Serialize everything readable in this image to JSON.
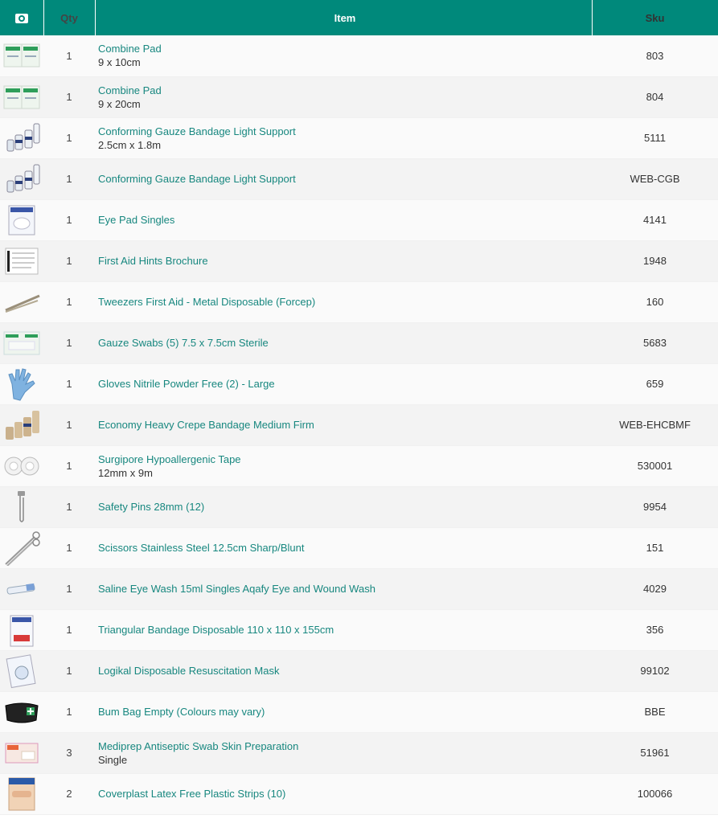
{
  "header": {
    "photo_icon": "camera-icon",
    "qty": "Qty",
    "item": "Item",
    "sku": "Sku"
  },
  "colors": {
    "header_bg": "#00897b",
    "link": "#17877f"
  },
  "rows": [
    {
      "icon": "combine-pad-thumbnail",
      "qty": "1",
      "name": "Combine Pad",
      "sub": "9 x 10cm",
      "sku": "803"
    },
    {
      "icon": "combine-pad-thumbnail",
      "qty": "1",
      "name": "Combine Pad",
      "sub": "9 x 20cm",
      "sku": "804"
    },
    {
      "icon": "gauze-bandage-thumbnail",
      "qty": "1",
      "name": "Conforming Gauze Bandage Light Support",
      "sub": "2.5cm x 1.8m",
      "sku": "5111"
    },
    {
      "icon": "gauze-bandage-thumbnail",
      "qty": "1",
      "name": "Conforming Gauze Bandage Light Support",
      "sub": "",
      "sku": "WEB-CGB"
    },
    {
      "icon": "eye-pad-thumbnail",
      "qty": "1",
      "name": "Eye Pad Singles",
      "sub": "",
      "sku": "4141"
    },
    {
      "icon": "brochure-thumbnail",
      "qty": "1",
      "name": "First Aid Hints Brochure",
      "sub": "",
      "sku": "1948"
    },
    {
      "icon": "tweezers-thumbnail",
      "qty": "1",
      "name": "Tweezers First Aid - Metal Disposable (Forcep)",
      "sub": "",
      "sku": "160"
    },
    {
      "icon": "gauze-swabs-thumbnail",
      "qty": "1",
      "name": "Gauze Swabs (5) 7.5 x 7.5cm Sterile",
      "sub": "",
      "sku": "5683"
    },
    {
      "icon": "gloves-thumbnail",
      "qty": "1",
      "name": "Gloves Nitrile Powder Free (2) - Large",
      "sub": "",
      "sku": "659"
    },
    {
      "icon": "crepe-bandage-thumbnail",
      "qty": "1",
      "name": "Economy Heavy Crepe Bandage Medium Firm",
      "sub": "",
      "sku": "WEB-EHCBMF"
    },
    {
      "icon": "tape-thumbnail",
      "qty": "1",
      "name": "Surgipore Hypoallergenic Tape",
      "sub": "12mm x 9m",
      "sku": "530001"
    },
    {
      "icon": "safety-pin-thumbnail",
      "qty": "1",
      "name": "Safety Pins 28mm (12)",
      "sub": "",
      "sku": "9954"
    },
    {
      "icon": "scissors-thumbnail",
      "qty": "1",
      "name": "Scissors Stainless Steel 12.5cm Sharp/Blunt",
      "sub": "",
      "sku": "151"
    },
    {
      "icon": "eye-wash-thumbnail",
      "qty": "1",
      "name": "Saline Eye Wash 15ml Singles Aqafy Eye and Wound Wash",
      "sub": "",
      "sku": "4029"
    },
    {
      "icon": "triangular-bandage-thumbnail",
      "qty": "1",
      "name": "Triangular Bandage Disposable 110 x 110 x 155cm",
      "sub": "",
      "sku": "356"
    },
    {
      "icon": "resuscitation-mask-thumbnail",
      "qty": "1",
      "name": "Logikal Disposable Resuscitation Mask",
      "sub": "",
      "sku": "99102"
    },
    {
      "icon": "bum-bag-thumbnail",
      "qty": "1",
      "name": "Bum Bag Empty (Colours may vary)",
      "sub": "",
      "sku": "BBE"
    },
    {
      "icon": "antiseptic-swab-thumbnail",
      "qty": "3",
      "name": "Mediprep Antiseptic Swab Skin Preparation",
      "sub": "Single",
      "sku": "51961"
    },
    {
      "icon": "plastic-strips-thumbnail",
      "qty": "2",
      "name": "Coverplast Latex Free Plastic Strips (10)",
      "sub": "",
      "sku": "100066"
    }
  ]
}
